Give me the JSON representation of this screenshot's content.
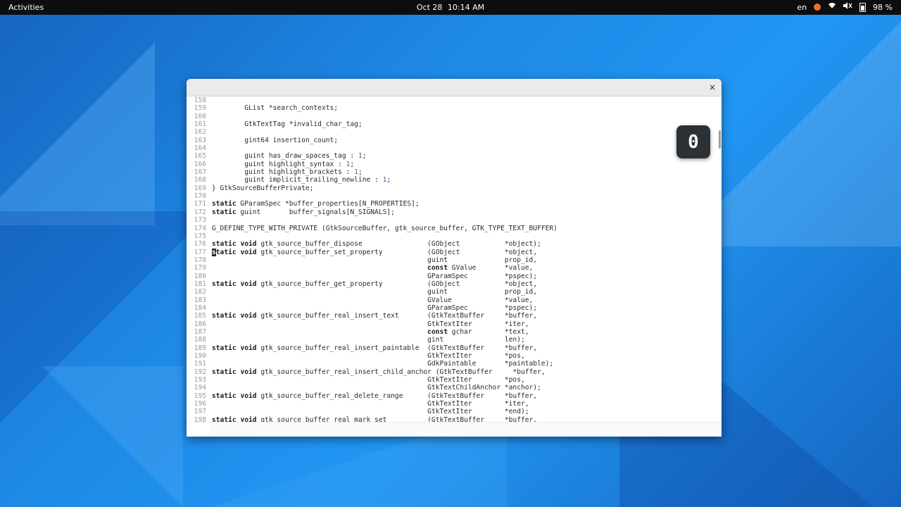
{
  "topbar": {
    "activities": "Activities",
    "date": "Oct 28",
    "time": "10:14 AM",
    "lang": "en",
    "battery": "98 %"
  },
  "icons": {
    "status": "orange-dot-icon",
    "wifi": "wifi-icon",
    "volume": "volume-icon",
    "battery": "battery-icon",
    "close": "close-icon"
  },
  "window": {
    "close_label": "×",
    "badge_value": "0"
  },
  "lines": [
    {
      "n": "158",
      "t": ""
    },
    {
      "n": "159",
      "t": "        GList *search_contexts;"
    },
    {
      "n": "160",
      "t": ""
    },
    {
      "n": "161",
      "t": "        GtkTextTag *invalid_char_tag;"
    },
    {
      "n": "162",
      "t": ""
    },
    {
      "n": "163",
      "t": "        gint64 insertion_count;"
    },
    {
      "n": "164",
      "t": ""
    },
    {
      "n": "165",
      "t": "        guint has_draw_spaces_tag : 1;"
    },
    {
      "n": "166",
      "t": "        guint highlight_syntax : 1;"
    },
    {
      "n": "167",
      "t": "        guint highlight_brackets : 1;"
    },
    {
      "n": "168",
      "t": "        guint implicit_trailing_newline : 1;"
    },
    {
      "n": "169",
      "t": "} GtkSourceBufferPrivate;"
    },
    {
      "n": "170",
      "t": ""
    },
    {
      "n": "171",
      "t": "static GParamSpec *buffer_properties[N_PROPERTIES];"
    },
    {
      "n": "172",
      "t": "static guint       buffer_signals[N_SIGNALS];"
    },
    {
      "n": "173",
      "t": ""
    },
    {
      "n": "174",
      "t": "G_DEFINE_TYPE_WITH_PRIVATE (GtkSourceBuffer, gtk_source_buffer, GTK_TYPE_TEXT_BUFFER)"
    },
    {
      "n": "175",
      "t": ""
    },
    {
      "n": "176",
      "t": "static void gtk_source_buffer_dispose                (GObject           *object);"
    },
    {
      "n": "177",
      "t": "static void gtk_source_buffer_set_property           (GObject           *object,"
    },
    {
      "n": "178",
      "t": "                                                     guint              prop_id,"
    },
    {
      "n": "179",
      "t": "                                                     const GValue       *value,"
    },
    {
      "n": "180",
      "t": "                                                     GParamSpec         *pspec);"
    },
    {
      "n": "181",
      "t": "static void gtk_source_buffer_get_property           (GObject           *object,"
    },
    {
      "n": "182",
      "t": "                                                     guint              prop_id,"
    },
    {
      "n": "183",
      "t": "                                                     GValue             *value,"
    },
    {
      "n": "184",
      "t": "                                                     GParamSpec         *pspec);"
    },
    {
      "n": "185",
      "t": "static void gtk_source_buffer_real_insert_text       (GtkTextBuffer     *buffer,"
    },
    {
      "n": "186",
      "t": "                                                     GtkTextIter        *iter,"
    },
    {
      "n": "187",
      "t": "                                                     const gchar        *text,"
    },
    {
      "n": "188",
      "t": "                                                     gint               len);"
    },
    {
      "n": "189",
      "t": "static void gtk_source_buffer_real_insert_paintable  (GtkTextBuffer     *buffer,"
    },
    {
      "n": "190",
      "t": "                                                     GtkTextIter        *pos,"
    },
    {
      "n": "191",
      "t": "                                                     GdkPaintable       *paintable);"
    },
    {
      "n": "192",
      "t": "static void gtk_source_buffer_real_insert_child_anchor (GtkTextBuffer     *buffer,"
    },
    {
      "n": "193",
      "t": "                                                     GtkTextIter        *pos,"
    },
    {
      "n": "194",
      "t": "                                                     GtkTextChildAnchor *anchor);"
    },
    {
      "n": "195",
      "t": "static void gtk_source_buffer_real_delete_range      (GtkTextBuffer     *buffer,"
    },
    {
      "n": "196",
      "t": "                                                     GtkTextIter        *iter,"
    },
    {
      "n": "197",
      "t": "                                                     GtkTextIter        *end);"
    },
    {
      "n": "198",
      "t": "static void gtk_source_buffer_real_mark_set          (GtkTextBuffer     *buffer,"
    }
  ]
}
